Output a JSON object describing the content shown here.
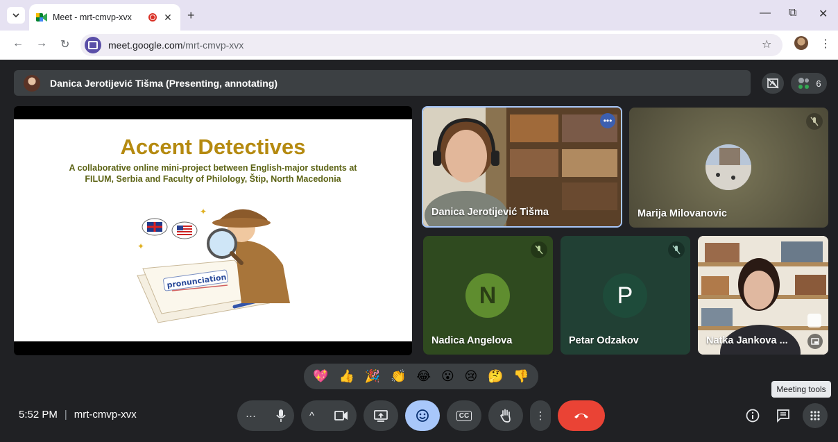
{
  "browser": {
    "tab_title": "Meet - mrt-cmvp-xvx",
    "tab_list_icon": "chevron-down-icon",
    "close_tab": "✕",
    "new_tab": "+",
    "url_host": "meet.google.com",
    "url_path": "/mrt-cmvp-xvx",
    "window_controls": {
      "minimize": "—",
      "restore": "⧉",
      "close": "✕"
    }
  },
  "meet": {
    "presenter_banner": "Danica Jerotijević Tišma (Presenting, annotating)",
    "participant_count": "6",
    "slide": {
      "title": "Accent Detectives",
      "subtitle": "A collaborative online mini-project between English-major students at FILUM, Serbia and Faculty of Philology, Štip, North Macedonia",
      "paper_word": "pronunciation"
    },
    "participants": [
      {
        "name": "Danica Jerotijević Tišma",
        "muted": false,
        "video": true
      },
      {
        "name": "Marija Milovanovic",
        "muted": true,
        "video": false
      },
      {
        "name": "Nadica Angelova",
        "muted": true,
        "avatar_letter": "N",
        "avatar_color": "#5f8d2f",
        "tile_color": "#2f4a1f"
      },
      {
        "name": "Petar Odzakov",
        "muted": true,
        "avatar_letter": "P",
        "avatar_color": "#1e4b3a",
        "tile_color": "#214034"
      },
      {
        "name": "Natka Jankova ...",
        "muted": false,
        "video": true
      }
    ],
    "reactions": [
      "💖",
      "👍",
      "🎉",
      "👏",
      "😂",
      "😮",
      "😢",
      "🤔",
      "👎"
    ],
    "tooltip": "Meeting tools",
    "time": "5:52 PM",
    "meeting_code": "mrt-cmvp-xvx",
    "controls": {
      "more_options": "···",
      "mic": "mic-icon",
      "camera_options": "^",
      "camera": "camera-icon",
      "present": "present-icon",
      "emoji": "emoji-icon",
      "captions": "CC",
      "raise_hand": "hand-icon",
      "more": "⋮",
      "hangup": "hangup-icon"
    }
  },
  "colors": {
    "meet_bg": "#202124",
    "accent_blue": "#a8c7fa",
    "hangup_red": "#ea4335",
    "slide_title": "#b58a10"
  }
}
